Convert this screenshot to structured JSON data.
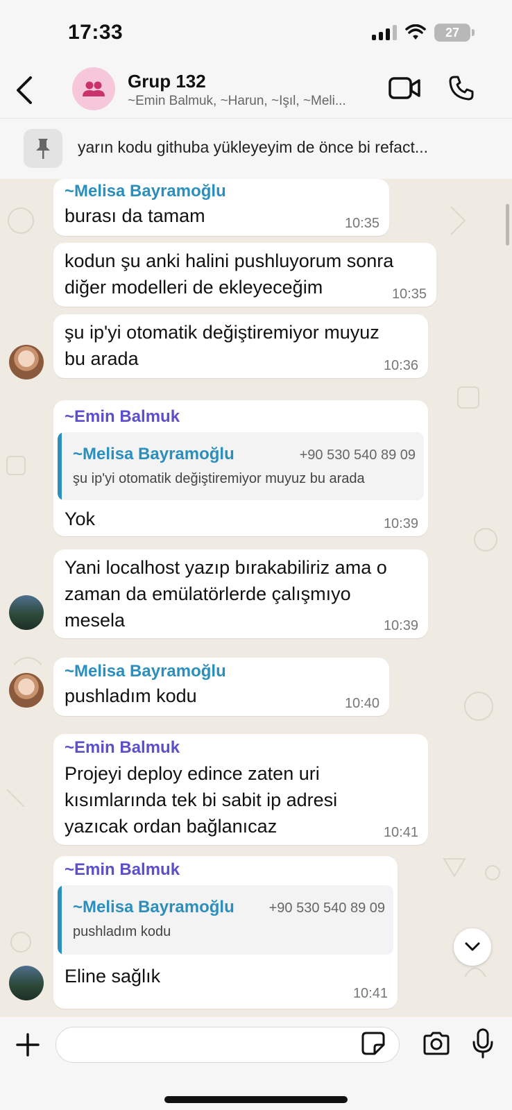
{
  "status_bar": {
    "time": "17:33",
    "battery": "27"
  },
  "header": {
    "title": "Grup 132",
    "members": "~Emin Balmuk, ~Harun, ~Işıl, ~Meli..."
  },
  "pinned": {
    "text": "yarın kodu githuba yükleyeyim de önce bi refact..."
  },
  "messages": [
    {
      "sender": "~Melisa Bayramoğlu",
      "lines": [
        "burası da tamam"
      ],
      "time": "10:35"
    },
    {
      "lines": [
        "kodun şu anki halini pushluyorum sonra",
        "diğer modelleri de ekleyeceğim"
      ],
      "time": "10:35"
    },
    {
      "lines": [
        "şu ip'yi otomatik değiştiremiyor muyuz",
        "bu arada"
      ],
      "time": "10:36"
    },
    {
      "sender": "~Emin Balmuk",
      "quote": {
        "name": "~Melisa Bayramoğlu",
        "phone": "+90 530 540 89 09",
        "text": "şu ip'yi otomatik değiştiremiyor muyuz bu arada"
      },
      "lines": [
        "Yok"
      ],
      "time": "10:39"
    },
    {
      "lines": [
        "Yani localhost yazıp bırakabiliriz ama o",
        "zaman da emülatörlerde çalışmıyo",
        "mesela"
      ],
      "time": "10:39"
    },
    {
      "sender": "~Melisa Bayramoğlu",
      "lines": [
        "pushladım kodu"
      ],
      "time": "10:40"
    },
    {
      "sender": "~Emin Balmuk",
      "lines": [
        "Projeyi deploy edince zaten uri",
        "kısımlarında tek bi sabit ip adresi",
        "yazıcak ordan bağlanıcaz"
      ],
      "time": "10:41"
    },
    {
      "sender": "~Emin Balmuk",
      "quote": {
        "name": "~Melisa Bayramoğlu",
        "phone": "+90 530 540 89 09",
        "text": "pushladım kodu"
      },
      "lines": [
        "Eline sağlık"
      ],
      "time": "10:41"
    }
  ],
  "icons": {
    "back": "chevron-left-icon",
    "group": "group-icon",
    "video": "video-camera-icon",
    "call": "phone-icon",
    "pin": "pin-icon",
    "scroll_down": "chevron-down-icon",
    "plus": "plus-icon",
    "sticker": "sticker-icon",
    "camera": "camera-icon",
    "mic": "microphone-icon"
  },
  "colors": {
    "melisa_name": "#2a8fbd",
    "emin_name": "#5b50c9",
    "chat_background": "#efeae2",
    "group_avatar": "#f6c7d9"
  }
}
